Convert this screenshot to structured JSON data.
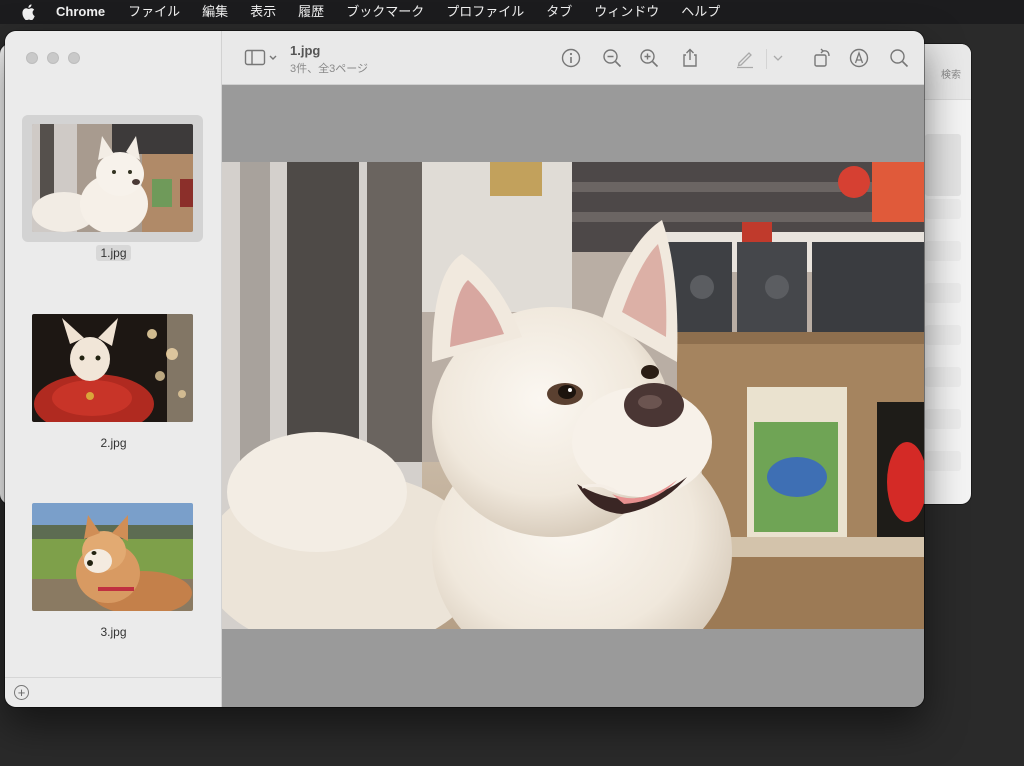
{
  "menubar": {
    "app_name": "Chrome",
    "items": [
      "ファイル",
      "編集",
      "表示",
      "履歴",
      "ブックマーク",
      "プロファイル",
      "タブ",
      "ウィンドウ",
      "ヘルプ"
    ]
  },
  "background_window": {
    "search_label": "検索"
  },
  "preview": {
    "title": "1.jpg",
    "subtitle": "3件、全3ページ",
    "thumbnails": [
      {
        "label": "1.jpg",
        "selected": true
      },
      {
        "label": "2.jpg",
        "selected": false
      },
      {
        "label": "3.jpg",
        "selected": false
      }
    ],
    "toolbar_icons": [
      "sidebar-toggle-icon",
      "info-icon",
      "zoom-out-icon",
      "zoom-in-icon",
      "share-icon",
      "markup-pen-icon",
      "rotate-icon",
      "markup-circle-icon",
      "search-icon"
    ]
  },
  "colors": {
    "menubar_bg": "#1c1c1e",
    "sidebar_bg": "#ebebeb",
    "toolbar_bg": "#e9e9e9",
    "canvas_bg": "#9a9a9a",
    "selection_bg": "#d3d3d3"
  }
}
